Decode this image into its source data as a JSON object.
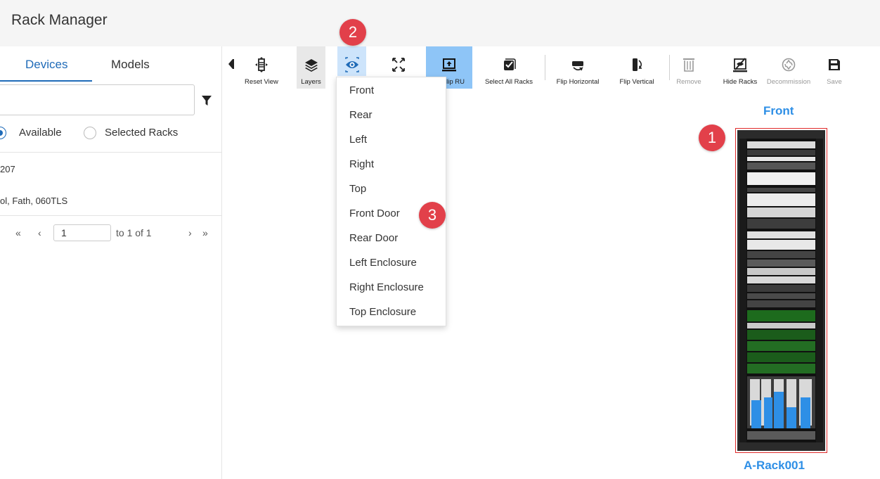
{
  "app": {
    "title": "Rack Manager"
  },
  "left_panel": {
    "tabs": [
      {
        "label": "Devices",
        "active": true
      },
      {
        "label": "Models",
        "active": false
      }
    ],
    "search": {
      "placeholder": "",
      "value": ""
    },
    "filter_icon": "filter-icon",
    "radios": [
      {
        "label": "Available",
        "selected": true
      },
      {
        "label": "Selected Racks",
        "selected": false
      }
    ],
    "list": [
      {
        "text": "207"
      },
      {
        "text": "ol, Fath, 060TLS"
      }
    ],
    "pager": {
      "first": "«",
      "prev": "‹",
      "page_value": "1",
      "to_text": "to 1 of 1",
      "next": "›",
      "last": "»"
    }
  },
  "toolbar": {
    "buttons": [
      {
        "label": "Reset View",
        "icon": "reset-view-icon"
      },
      {
        "label": "Layers",
        "icon": "layers-icon"
      },
      {
        "label": "",
        "icon": "eye-icon",
        "state": "open"
      },
      {
        "label": "",
        "icon": "fullscreen-icon"
      },
      {
        "label": "Flip RU",
        "icon": "flip-ru-icon",
        "state": "active"
      },
      {
        "label": "Select All Racks",
        "icon": "select-all-icon"
      },
      {
        "label": "Flip Horizontal",
        "icon": "flip-horizontal-icon"
      },
      {
        "label": "Flip Vertical",
        "icon": "flip-vertical-icon"
      },
      {
        "label": "Remove",
        "icon": "trash-icon",
        "disabled": true
      },
      {
        "label": "Hide Racks",
        "icon": "hide-racks-icon"
      },
      {
        "label": "Decommission",
        "icon": "recycle-icon",
        "disabled": true
      },
      {
        "label": "Save",
        "icon": "save-icon",
        "disabled": true
      }
    ]
  },
  "view_menu": {
    "items": [
      "Front",
      "Rear",
      "Left",
      "Right",
      "Top",
      "Front Door",
      "Rear Door",
      "Left Enclosure",
      "Right Enclosure",
      "Top Enclosure"
    ]
  },
  "badges": [
    "1",
    "2",
    "3"
  ],
  "rack": {
    "view_title": "Front",
    "name": "A-Rack001"
  },
  "colors": {
    "accent": "#1f6bb8",
    "badge": "#e2404a",
    "rack_label": "#2e8fe6",
    "selection": "#e02a2a"
  }
}
